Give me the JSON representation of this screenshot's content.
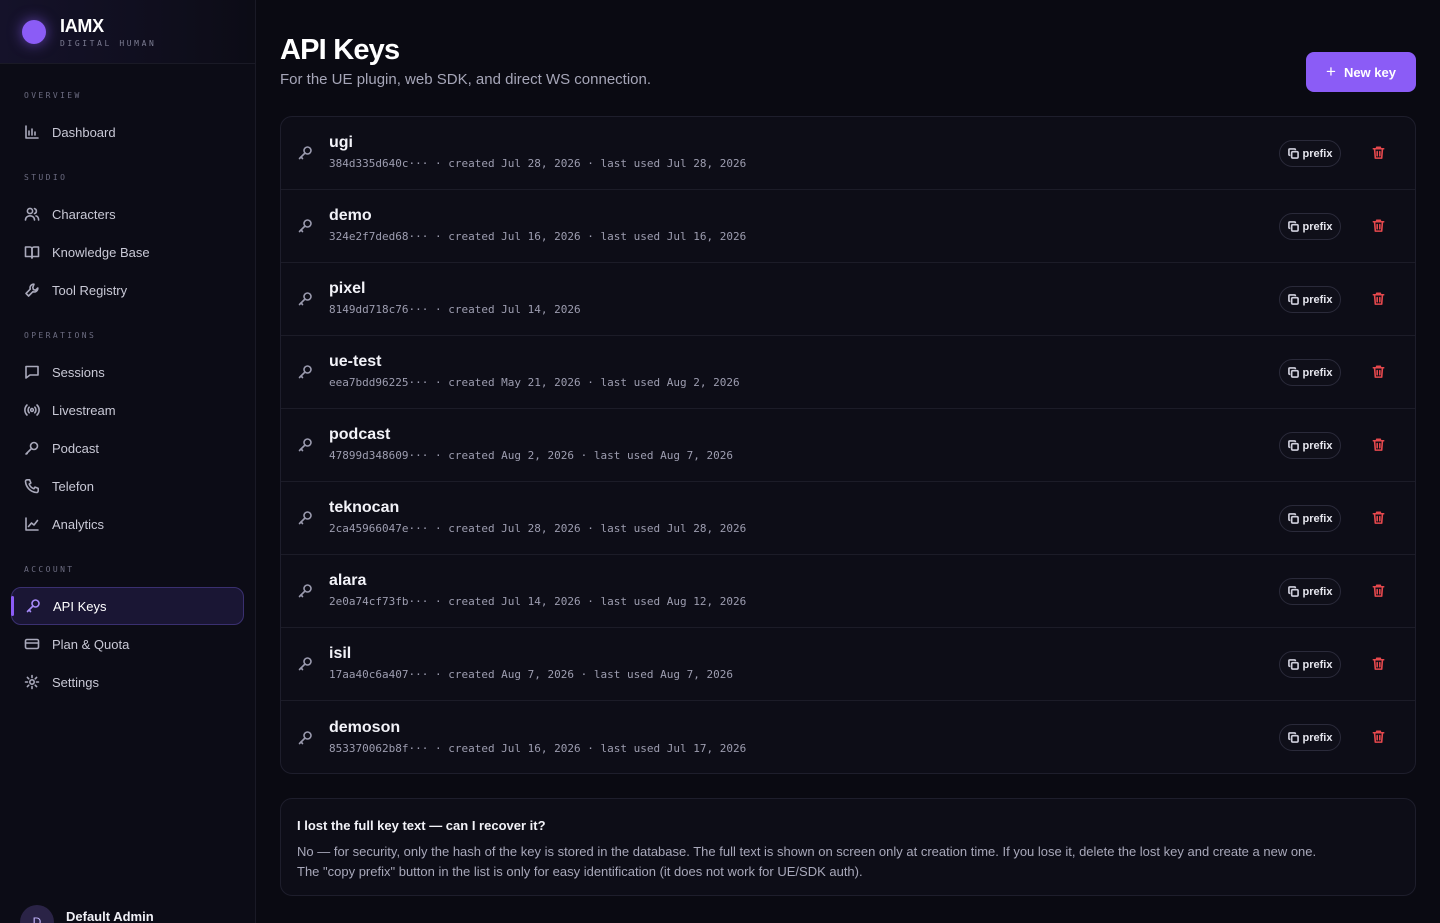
{
  "brand": {
    "name": "IAMX",
    "subtitle": "DIGITAL HUMAN"
  },
  "sidebar": {
    "sections": [
      {
        "label": "OVERVIEW",
        "items": [
          {
            "label": "Dashboard",
            "icon": "bar-chart-icon"
          }
        ]
      },
      {
        "label": "STUDIO",
        "items": [
          {
            "label": "Characters",
            "icon": "users-icon"
          },
          {
            "label": "Knowledge Base",
            "icon": "book-icon"
          },
          {
            "label": "Tool Registry",
            "icon": "wrench-icon"
          }
        ]
      },
      {
        "label": "OPERATIONS",
        "items": [
          {
            "label": "Sessions",
            "icon": "chat-icon"
          },
          {
            "label": "Livestream",
            "icon": "broadcast-icon"
          },
          {
            "label": "Podcast",
            "icon": "microphone-icon"
          },
          {
            "label": "Telefon",
            "icon": "phone-icon"
          },
          {
            "label": "Analytics",
            "icon": "line-chart-icon"
          }
        ]
      },
      {
        "label": "ACCOUNT",
        "items": [
          {
            "label": "API Keys",
            "icon": "key-icon",
            "active": true
          },
          {
            "label": "Plan & Quota",
            "icon": "credit-card-icon"
          },
          {
            "label": "Settings",
            "icon": "gear-icon"
          }
        ]
      }
    ],
    "user": {
      "name": "Default Admin",
      "initial": "D"
    }
  },
  "header": {
    "title": "API Keys",
    "subtitle": "For the UE plugin, web SDK, and direct WS connection.",
    "new_key_label": "New key"
  },
  "keys": [
    {
      "name": "ugi",
      "meta": "384d335d640c··· · created Jul 28, 2026 · last used Jul 28, 2026",
      "prefix_label": "prefix"
    },
    {
      "name": "demo",
      "meta": "324e2f7ded68··· · created Jul 16, 2026 · last used Jul 16, 2026",
      "prefix_label": "prefix"
    },
    {
      "name": "pixel",
      "meta": "8149dd718c76··· · created Jul 14, 2026",
      "prefix_label": "prefix"
    },
    {
      "name": "ue-test",
      "meta": "eea7bdd96225··· · created May 21, 2026 · last used Aug 2, 2026",
      "prefix_label": "prefix"
    },
    {
      "name": "podcast",
      "meta": "47899d348609··· · created Aug 2, 2026 · last used Aug 7, 2026",
      "prefix_label": "prefix"
    },
    {
      "name": "teknocan",
      "meta": "2ca45966047e··· · created Jul 28, 2026 · last used Jul 28, 2026",
      "prefix_label": "prefix"
    },
    {
      "name": "alara",
      "meta": "2e0a74cf73fb··· · created Jul 14, 2026 · last used Aug 12, 2026",
      "prefix_label": "prefix"
    },
    {
      "name": "isil",
      "meta": "17aa40c6a407··· · created Aug 7, 2026 · last used Aug 7, 2026",
      "prefix_label": "prefix"
    },
    {
      "name": "demoson",
      "meta": "853370062b8f··· · created Jul 16, 2026 · last used Jul 17, 2026",
      "prefix_label": "prefix"
    }
  ],
  "faq": {
    "question": "I lost the full key text — can I recover it?",
    "answer_line1": "No — for security, only the hash of the key is stored in the database. The full text is shown on screen only at creation time. If you lose it, delete the lost key and create a new one.",
    "answer_line2": "The \"copy prefix\" button in the list is only for easy identification (it does not work for UE/SDK auth)."
  },
  "colors": {
    "accent": "#8b5cf6",
    "danger": "#e5484d",
    "background": "#0a0a12"
  }
}
